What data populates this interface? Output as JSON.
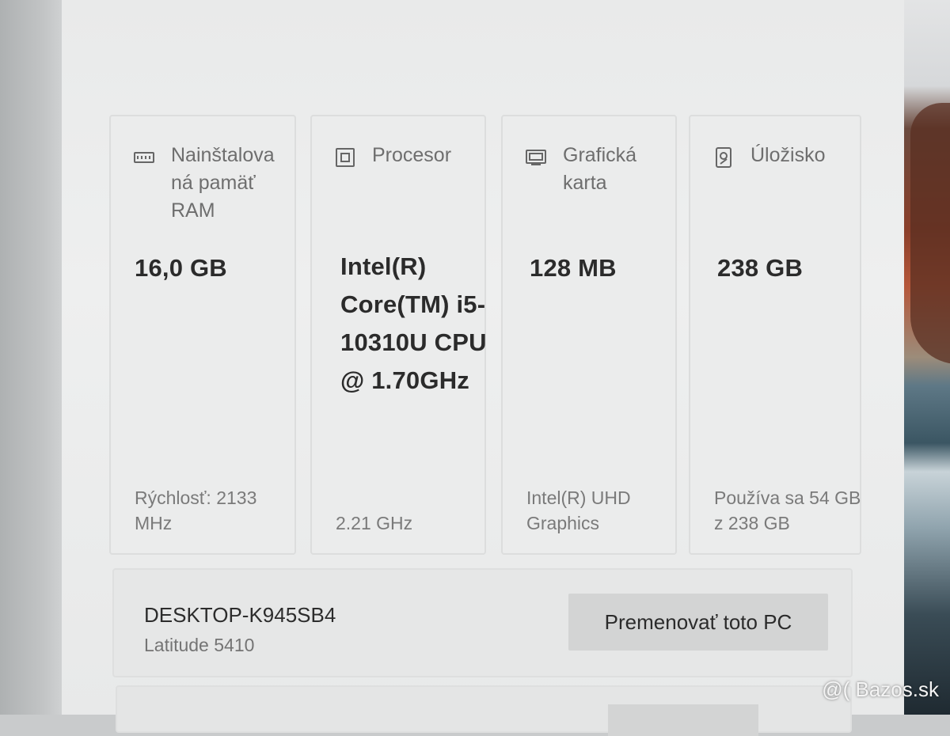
{
  "specs": {
    "ram": {
      "icon": "memory-icon",
      "label": "Nainštalova ná pamäť RAM",
      "value": "16,0 GB",
      "sub": "Rýchlosť: 2133 MHz"
    },
    "cpu": {
      "icon": "processor-icon",
      "label": "Procesor",
      "value": "Intel(R) Core(TM) i5-10310U CPU @ 1.70GHz",
      "sub": "2.21 GHz"
    },
    "gpu": {
      "icon": "graphics-card-icon",
      "label": "Grafická karta",
      "value": "128 MB",
      "sub": "Intel(R) UHD Graphics"
    },
    "storage": {
      "icon": "storage-icon",
      "label": "Úložisko",
      "value": "238 GB",
      "sub": "Používa sa 54 GB z 238 GB"
    }
  },
  "device": {
    "name": "DESKTOP-K945SB4",
    "model": "Latitude 5410",
    "rename_label": "Premenovať toto PC"
  },
  "watermark": "@( Bazos.sk"
}
